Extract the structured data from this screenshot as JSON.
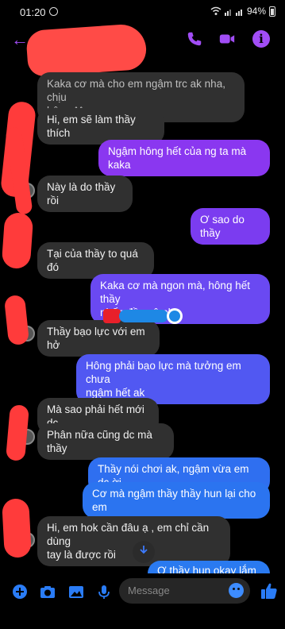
{
  "status_bar": {
    "time": "01:20",
    "battery": "94%"
  },
  "header": {
    "back": "←"
  },
  "messages": [
    {
      "side": "in",
      "text": "Kaka cơ mà cho em ngậm trc ak nha, chịu\nhông ^^"
    },
    {
      "side": "in",
      "text": "Hi, em sẽ làm thầy thích"
    },
    {
      "side": "out",
      "text": "Ngậm hông hết của ng ta mà kaka",
      "color": "#8a37f0"
    },
    {
      "side": "in",
      "text": "Này là do thầy rồi"
    },
    {
      "side": "out",
      "text": "Ơ sao do thầy",
      "color": "#7b3cf0"
    },
    {
      "side": "in",
      "text": "Tại của thầy to quá đó"
    },
    {
      "side": "out",
      "text": "Kaka cơ mà ngon mà, hông hết thầy\nnhấn đầu vô nha",
      "color": "#6a49f2"
    },
    {
      "side": "in",
      "text": "Thầy bạo lực với em hở"
    },
    {
      "side": "out",
      "text": "Hông phải bạo lực mà tưởng em chưa\nngậm hết ak",
      "color": "#5158f2"
    },
    {
      "side": "in",
      "text": "Mà sao phải hết mới dc"
    },
    {
      "side": "in",
      "text": "Phân nữa cũng dc mà thầy"
    },
    {
      "side": "out",
      "text": "Thầy nói chơi ak, ngậm vừa em dc ời",
      "color": "#2f6ff0"
    },
    {
      "side": "out",
      "text": "Cơ mà ngậm thầy thầy hun lại cho em",
      "color": "#2b74f0"
    },
    {
      "side": "in",
      "text": "Hi, em hok cần đâu ạ , em chỉ cần dùng\ntay là được rồi"
    },
    {
      "side": "out",
      "text": "Ơ thầy hun okay lắm ak",
      "color": "#2a7af0"
    }
  ],
  "composer": {
    "placeholder": "Message"
  },
  "colors": {
    "accent": "#a14df5",
    "composer_blue": "#2a7cf6"
  },
  "icons": [
    "back-arrow-icon",
    "phone-icon",
    "video-camera-icon",
    "info-icon",
    "plus-icon",
    "camera-icon",
    "gallery-icon",
    "microphone-icon",
    "emoji-icon",
    "thumbs-up-icon",
    "chevron-down-icon"
  ]
}
